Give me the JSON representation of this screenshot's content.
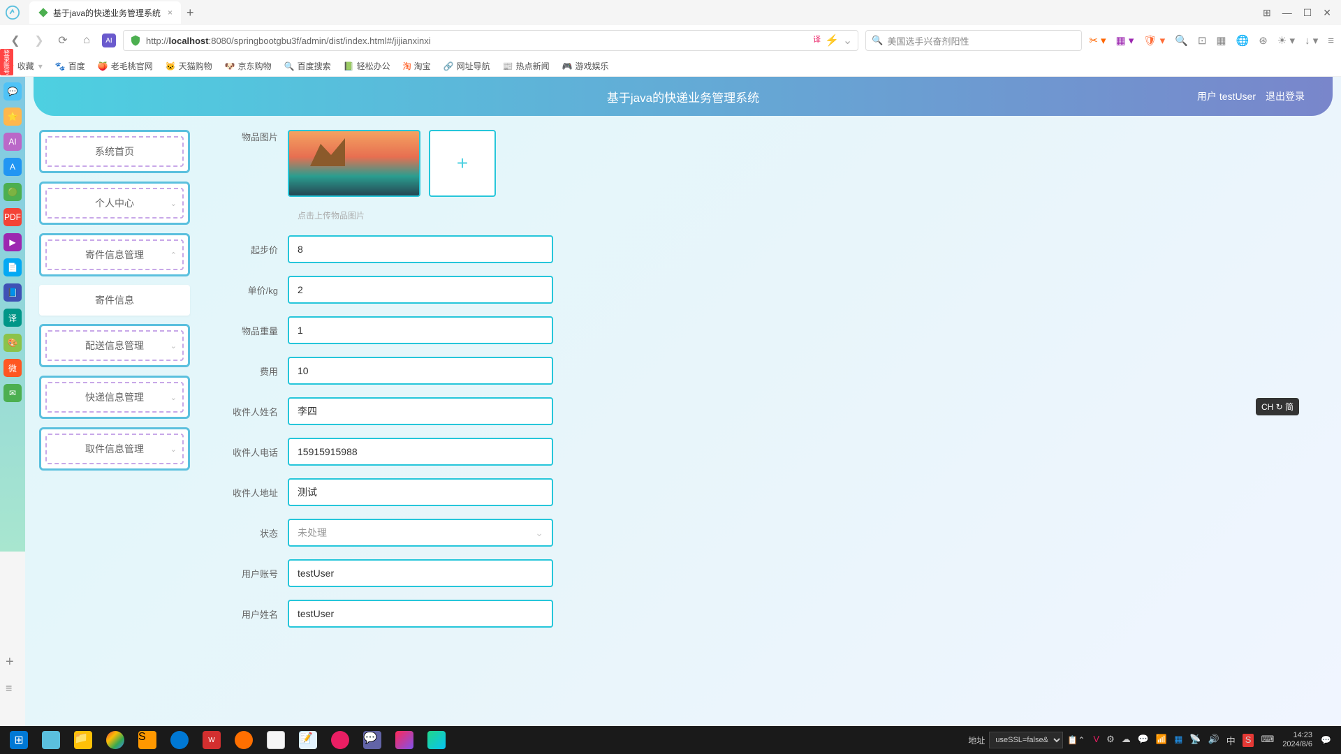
{
  "browser": {
    "tab_title": "基于java的快递业务管理系统",
    "url_prefix": "http://",
    "url_host": "localhost",
    "url_path": ":8080/springbootgbu3f/admin/dist/index.html#/jijianxinxi",
    "search_placeholder": "美国选手兴奋剂阳性",
    "bookmarks": {
      "collect": "收藏",
      "baidu": "百度",
      "laomao": "老毛桃官网",
      "tmall": "天猫购物",
      "jd": "京东购物",
      "baidusearch": "百度搜索",
      "qingban": "轻松办公",
      "taobao": "淘宝",
      "wangzhi": "网址导航",
      "hotnews": "热点新闻",
      "youxi": "游戏娱乐"
    }
  },
  "dock_badge": "登录账号",
  "app": {
    "title": "基于java的快递业务管理系统",
    "user_label": "用户 testUser",
    "logout": "退出登录"
  },
  "sidebar": {
    "items": [
      {
        "label": "系统首页",
        "expandable": false
      },
      {
        "label": "个人中心",
        "expandable": true
      },
      {
        "label": "寄件信息管理",
        "expandable": true,
        "expanded": true
      },
      {
        "label": "寄件信息",
        "sub": true
      },
      {
        "label": "配送信息管理",
        "expandable": true
      },
      {
        "label": "快递信息管理",
        "expandable": true
      },
      {
        "label": "取件信息管理",
        "expandable": true
      }
    ]
  },
  "form": {
    "image_label": "物品图片",
    "upload_hint": "点击上传物品图片",
    "fields": {
      "start_price": {
        "label": "起步价",
        "value": "8"
      },
      "unit_price": {
        "label": "单价/kg",
        "value": "2"
      },
      "weight": {
        "label": "物品重量",
        "value": "1"
      },
      "fee": {
        "label": "费用",
        "value": "10"
      },
      "recv_name": {
        "label": "收件人姓名",
        "value": "李四"
      },
      "recv_phone": {
        "label": "收件人电话",
        "value": "15915915988"
      },
      "recv_addr": {
        "label": "收件人地址",
        "value": "测试"
      },
      "status": {
        "label": "状态",
        "value": "未处理"
      },
      "account": {
        "label": "用户账号",
        "value": "testUser"
      },
      "username": {
        "label": "用户姓名",
        "value": "testUser"
      }
    }
  },
  "ime": "CH ↻ 简",
  "taskbar": {
    "addr_label": "地址",
    "addr_value": "useSSL=false&",
    "time": "14:23",
    "date": "2024/8/6",
    "lang": "中"
  }
}
